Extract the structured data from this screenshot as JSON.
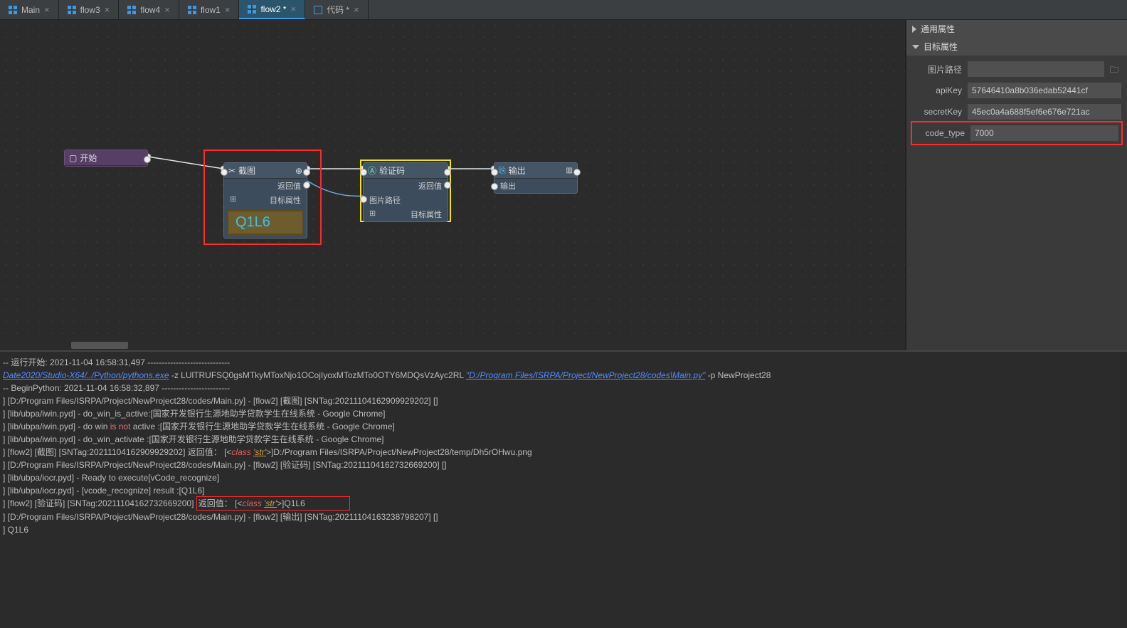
{
  "tabs": [
    {
      "label": "Main",
      "modified": false
    },
    {
      "label": "flow3",
      "modified": false
    },
    {
      "label": "flow4",
      "modified": false
    },
    {
      "label": "flow1",
      "modified": false
    },
    {
      "label": "flow2 *",
      "modified": true,
      "active": true
    },
    {
      "label": "代码 *",
      "modified": true,
      "codeIcon": true
    }
  ],
  "nodes": {
    "start": {
      "title": "开始"
    },
    "shot": {
      "title": "截图",
      "ret": "返回值",
      "prop": "目标属性",
      "captcha": "Q1L6"
    },
    "verify": {
      "title": "验证码",
      "ret": "返回值",
      "path": "图片路径",
      "prop": "目标属性"
    },
    "output": {
      "title": "输出",
      "port": "输出"
    }
  },
  "props": {
    "general": "通用属性",
    "target": "目标属性",
    "rows": [
      {
        "label": "图片路径",
        "value": ""
      },
      {
        "label": "apiKey",
        "value": "57646410a8b036edab52441cf"
      },
      {
        "label": "secretKey",
        "value": "45ec0a4a688f5ef6e676e721ac"
      },
      {
        "label": "code_type",
        "value": "7000",
        "hl": true
      }
    ]
  },
  "console": {
    "lines": [
      {
        "t": "-- 运行开始: 2021-11-04 16:58:31,497 -----------------------------"
      },
      {
        "pre": "",
        "link1": "Date2020/Studio-X64/../Python/pythons.exe",
        "mid": "   -z LUlTRUFSQ0gsMTkyMToxNjo1OCojIyoxMTozMTo0OTY6MDQsVzAyc2RL ",
        "link2": "\"D:/Program Files/ISRPA/Project/NewProject28/codes\\Main.py\"",
        "tail": "  -p  NewProject28"
      },
      {
        "t": "-- BeginPython: 2021-11-04 16:58:32,897 ------------------------"
      },
      {
        "t": "] [D:/Program Files/ISRPA/Project/NewProject28/codes/Main.py] - [flow2] [截图] [SNTag:20211104162909929202] []"
      },
      {
        "t": "] [lib/ubpa/iwin.pyd] - do_win_is_active:[国家开发银行生源地助学贷款学生在线系统 - Google Chrome]"
      },
      {
        "pre": "] [lib/ubpa/iwin.pyd] - do win ",
        "red": "is not",
        "tail": " active :[国家开发银行生源地助学贷款学生在线系统 - Google Chrome]"
      },
      {
        "t": "] [lib/ubpa/iwin.pyd] - do_win_activate :[国家开发银行生源地助学贷款学生在线系统 - Google Chrome]"
      },
      {
        "pre": "] [flow2] [截图] [SNTag:20211104162909929202]    返回值：  [<",
        "cls": "class ",
        "str": "'str'",
        "tail": ">]D:/Program Files/ISRPA/Project/NewProject28/temp/Dh5rOHwu.png"
      },
      {
        "t": "] [D:/Program Files/ISRPA/Project/NewProject28/codes/Main.py] - [flow2] [验证码] [SNTag:20211104162732669200] []"
      },
      {
        "t": "] [lib/ubpa/iocr.pyd] - Ready to execute[vCode_recognize]"
      },
      {
        "t": "] [lib/ubpa/iocr.pyd] - [vcode_recognize] result :[Q1L6]"
      },
      {
        "pre": "] [flow2] [验证码] [SNTag:20211104162732669200] ",
        "hlpre": "返回值：  [<",
        "cls": "class ",
        "str": "'str'",
        "hltail": ">]Q1L6",
        "boxExtend": true
      },
      {
        "t": "] [D:/Program Files/ISRPA/Project/NewProject28/codes/Main.py] - [flow2] [输出] [SNTag:20211104163238798207] []"
      },
      {
        "t": "] Q1L6"
      }
    ]
  }
}
